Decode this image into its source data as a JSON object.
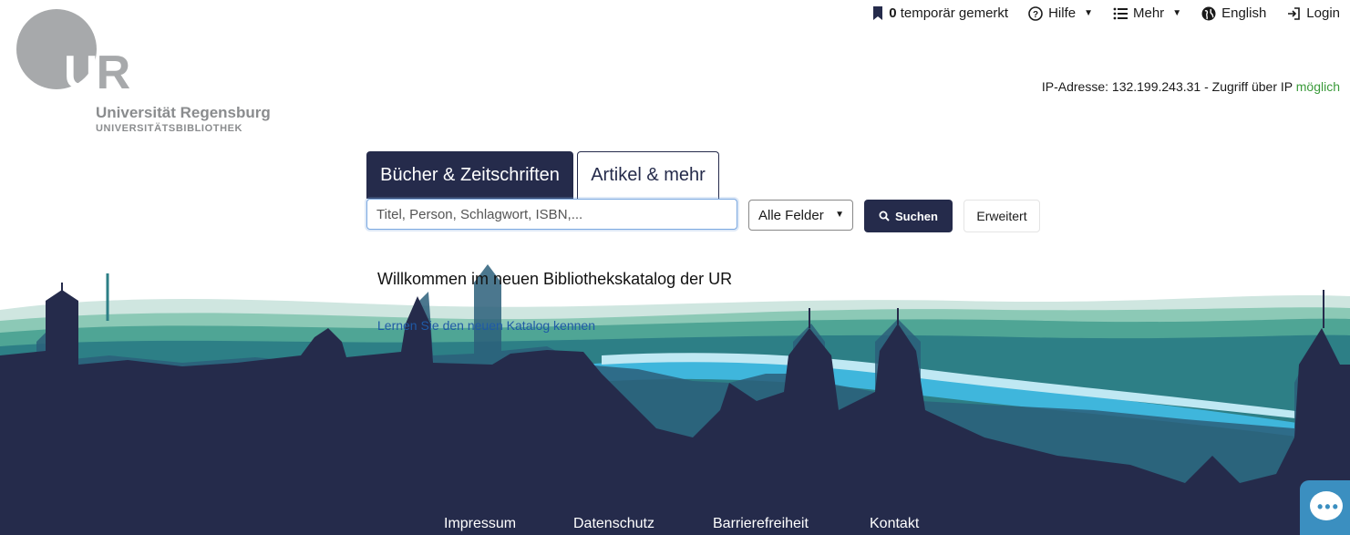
{
  "logo": {
    "letters_u": "U",
    "letters_r": "R",
    "line1": "Universität Regensburg",
    "line2": "UNIVERSITÄTSBIBLIOTHEK"
  },
  "topnav": {
    "saved_count": "0",
    "saved_label": "temporär gemerkt",
    "help_label": "Hilfe",
    "more_label": "Mehr",
    "language_label": "English",
    "login_label": "Login"
  },
  "ip": {
    "prefix": "IP-Adresse: 132.199.243.31 - Zugriff über IP",
    "status": "möglich"
  },
  "tabs": [
    {
      "label": "Bücher & Zeitschriften",
      "active": true
    },
    {
      "label": "Artikel & mehr",
      "active": false
    }
  ],
  "search": {
    "placeholder": "Titel, Person, Schlagwort, ISBN,...",
    "field_select": "Alle Felder",
    "submit_label": "Suchen",
    "advanced_label": "Erweitert"
  },
  "welcome": {
    "title": "Willkommen im neuen Bibliothekskatalog der UR",
    "link": "Lernen Sie den neuen Katalog kennen"
  },
  "footer": {
    "links": [
      "Impressum",
      "Datenschutz",
      "Barrierefreiheit",
      "Kontakt"
    ]
  },
  "colors": {
    "primary": "#252b4b",
    "accent_teal": "#2a8a8a",
    "river": "#3fb6dc",
    "ok_green": "#3a9a3a",
    "chat": "#3b8fc0"
  },
  "icons": [
    "bookmark-icon",
    "help-circle-icon",
    "list-icon",
    "globe-icon",
    "login-icon",
    "search-icon",
    "chat-icon"
  ]
}
